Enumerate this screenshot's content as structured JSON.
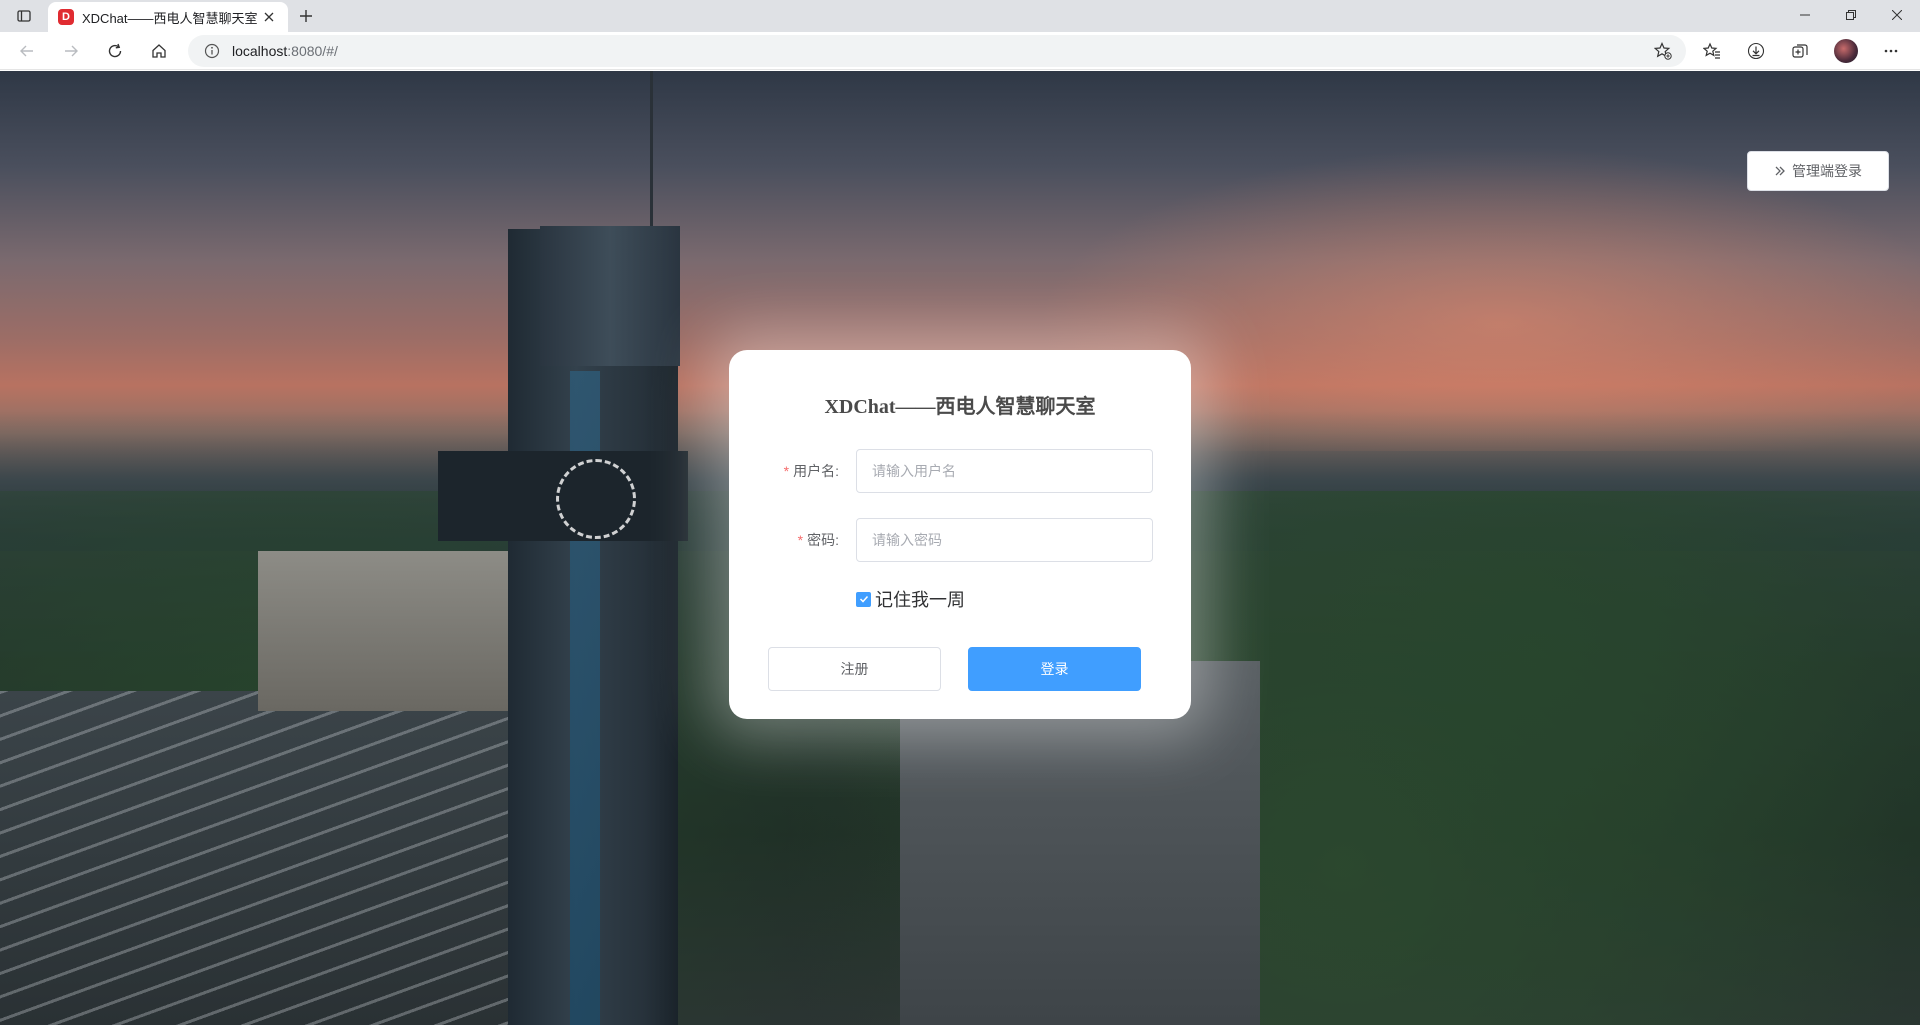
{
  "browser": {
    "tab_title": "XDChat——西电人智慧聊天室",
    "tab_favicon_letter": "D",
    "address_host": "localhost",
    "address_rest": ":8080/#/",
    "window_controls": [
      "minimize",
      "restore",
      "close"
    ]
  },
  "admin_login": {
    "label": "管理端登录",
    "icon": "double-chevron-right-icon"
  },
  "login": {
    "title": "XDChat——西电人智慧聊天室",
    "username_label": "用户名:",
    "username_placeholder": "请输入用户名",
    "username_value": "",
    "password_label": "密码:",
    "password_placeholder": "请输入密码",
    "password_value": "",
    "remember_label": "记住我一周",
    "remember_checked": true,
    "register_label": "注册",
    "login_label": "登录"
  },
  "colors": {
    "primary": "#409eff",
    "required": "#f56c6c",
    "favicon": "#e02b31"
  }
}
